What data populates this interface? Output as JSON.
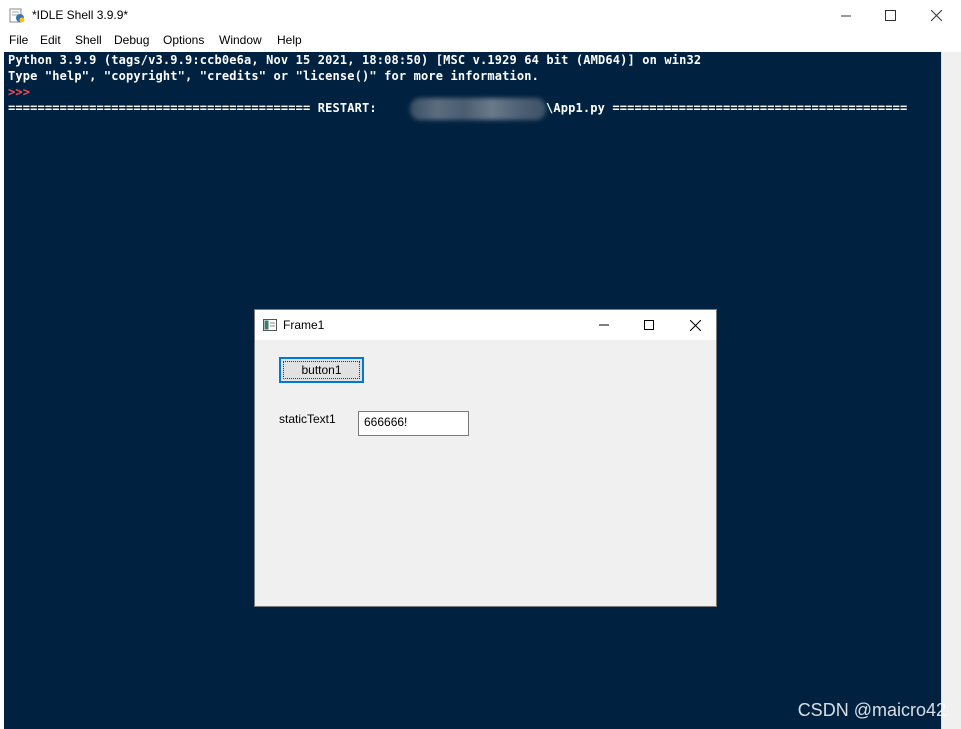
{
  "window": {
    "title": "*IDLE Shell 3.9.9*"
  },
  "menu": {
    "file": "File",
    "edit": "Edit",
    "shell": "Shell",
    "debug": "Debug",
    "options": "Options",
    "window": "Window",
    "help": "Help"
  },
  "shell": {
    "line1": "Python 3.9.9 (tags/v3.9.9:ccb0e6a, Nov 15 2021, 18:08:50) [MSC v.1929 64 bit (AMD64)] on win32",
    "line2": "Type \"help\", \"copyright\", \"credits\" or \"license()\" for more information.",
    "prompt": ">>>",
    "restart_left": "========================================= RESTART:",
    "restart_right": "\\App1.py ========================================"
  },
  "frame": {
    "title": "Frame1",
    "button_label": "button1",
    "static_text": "staticText1",
    "text_value": "666666!"
  },
  "watermark": "CSDN @maicro42",
  "colors": {
    "shell_bg": "#002240",
    "prompt": "#ff4a55",
    "focus_border": "#0078d7"
  }
}
